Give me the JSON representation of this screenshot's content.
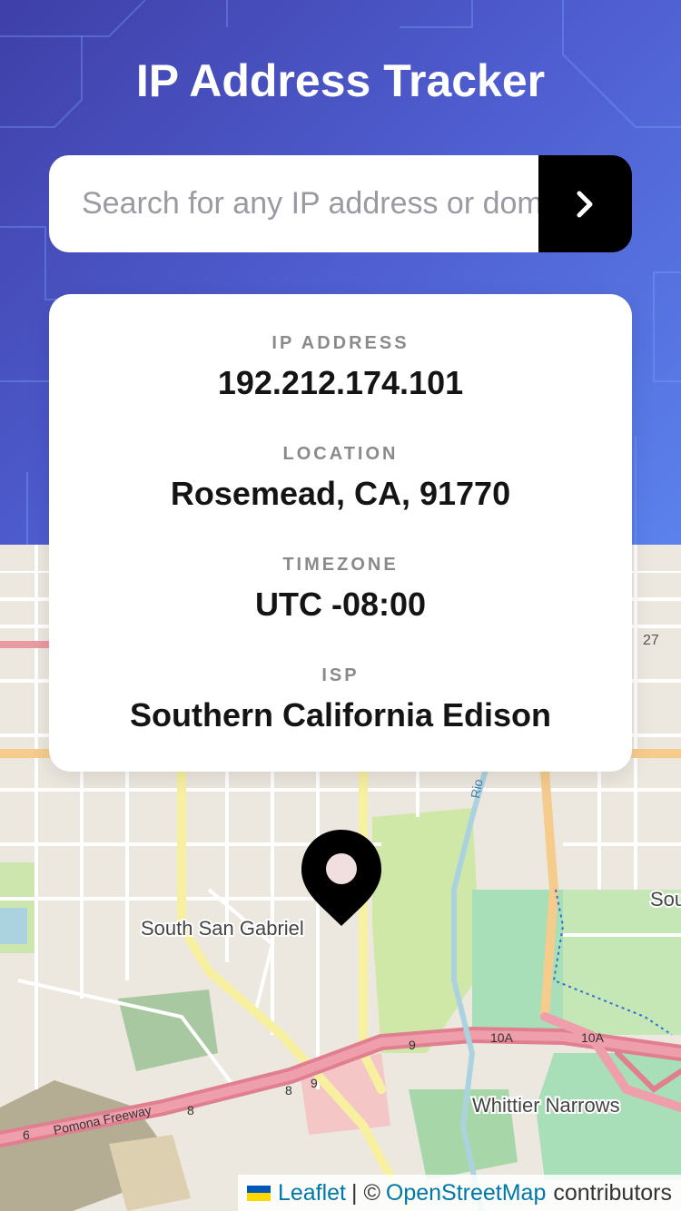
{
  "header": {
    "title": "IP Address Tracker"
  },
  "search": {
    "placeholder": "Search for any IP address or domain",
    "value": "",
    "button_icon": "chevron-right-icon"
  },
  "info": {
    "ip_label": "IP ADDRESS",
    "ip_value": "192.212.174.101",
    "location_label": "LOCATION",
    "location_value": "Rosemead, CA, 91770",
    "timezone_label": "TIMEZONE",
    "timezone_value": "UTC -08:00",
    "isp_label": "ISP",
    "isp_value": "Southern California Edison"
  },
  "map": {
    "place_labels": [
      "South San Gabriel",
      "Whittier Narrows",
      "Sou"
    ],
    "road_labels": [
      "Pomona Freeway",
      "10A",
      "10A",
      "9",
      "8",
      "9",
      "8",
      "6",
      "27"
    ],
    "river_label": "Rio",
    "marker_icon": "location-pin-icon",
    "attribution": {
      "flag_icon": "ukraine-flag-icon",
      "leaflet": "Leaflet",
      "separator": "| ©",
      "osm": "OpenStreetMap",
      "contributors": "contributors"
    }
  },
  "colors": {
    "header_gradient_start": "#3f3fa8",
    "header_gradient_end": "#5b82ec",
    "button": "#000000",
    "label": "#8a8a8a",
    "value": "#141414",
    "link": "#0078a8"
  }
}
